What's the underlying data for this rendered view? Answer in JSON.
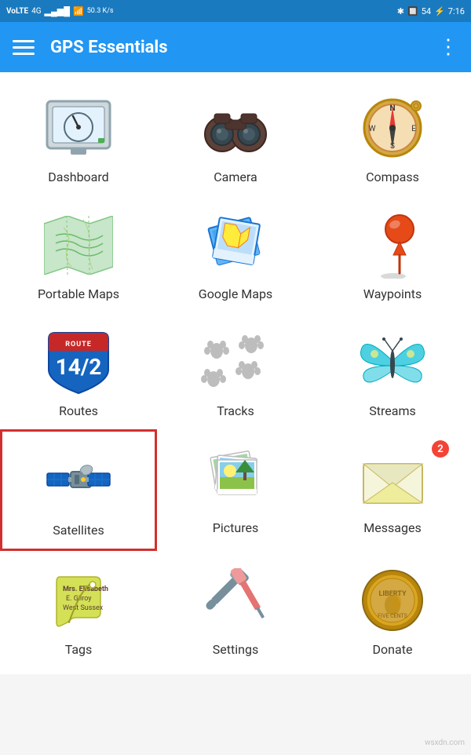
{
  "statusBar": {
    "left": "VoLTE 4G",
    "speed": "50.3 K/s",
    "right": "54",
    "time": "7:16"
  },
  "appBar": {
    "title": "GPS Essentials",
    "menuIcon": "menu-icon",
    "moreIcon": "more-icon"
  },
  "grid": {
    "items": [
      {
        "id": "dashboard",
        "label": "Dashboard",
        "icon": "dashboard-icon",
        "selected": false,
        "badge": null
      },
      {
        "id": "camera",
        "label": "Camera",
        "icon": "camera-icon",
        "selected": false,
        "badge": null
      },
      {
        "id": "compass",
        "label": "Compass",
        "icon": "compass-icon",
        "selected": false,
        "badge": null
      },
      {
        "id": "portable-maps",
        "label": "Portable Maps",
        "icon": "map-icon",
        "selected": false,
        "badge": null
      },
      {
        "id": "google-maps",
        "label": "Google Maps",
        "icon": "google-maps-icon",
        "selected": false,
        "badge": null
      },
      {
        "id": "waypoints",
        "label": "Waypoints",
        "icon": "waypoints-icon",
        "selected": false,
        "badge": null
      },
      {
        "id": "routes",
        "label": "Routes",
        "icon": "routes-icon",
        "selected": false,
        "badge": null
      },
      {
        "id": "tracks",
        "label": "Tracks",
        "icon": "tracks-icon",
        "selected": false,
        "badge": null
      },
      {
        "id": "streams",
        "label": "Streams",
        "icon": "streams-icon",
        "selected": false,
        "badge": null
      },
      {
        "id": "satellites",
        "label": "Satellites",
        "icon": "satellites-icon",
        "selected": true,
        "badge": null
      },
      {
        "id": "pictures",
        "label": "Pictures",
        "icon": "pictures-icon",
        "selected": false,
        "badge": null
      },
      {
        "id": "messages",
        "label": "Messages",
        "icon": "messages-icon",
        "selected": false,
        "badge": 2
      },
      {
        "id": "tags",
        "label": "Tags",
        "icon": "tags-icon",
        "selected": false,
        "badge": null
      },
      {
        "id": "settings",
        "label": "Settings",
        "icon": "settings-icon",
        "selected": false,
        "badge": null
      },
      {
        "id": "donate",
        "label": "Donate",
        "icon": "donate-icon",
        "selected": false,
        "badge": null
      }
    ]
  },
  "watermark": "wsxdn.com"
}
